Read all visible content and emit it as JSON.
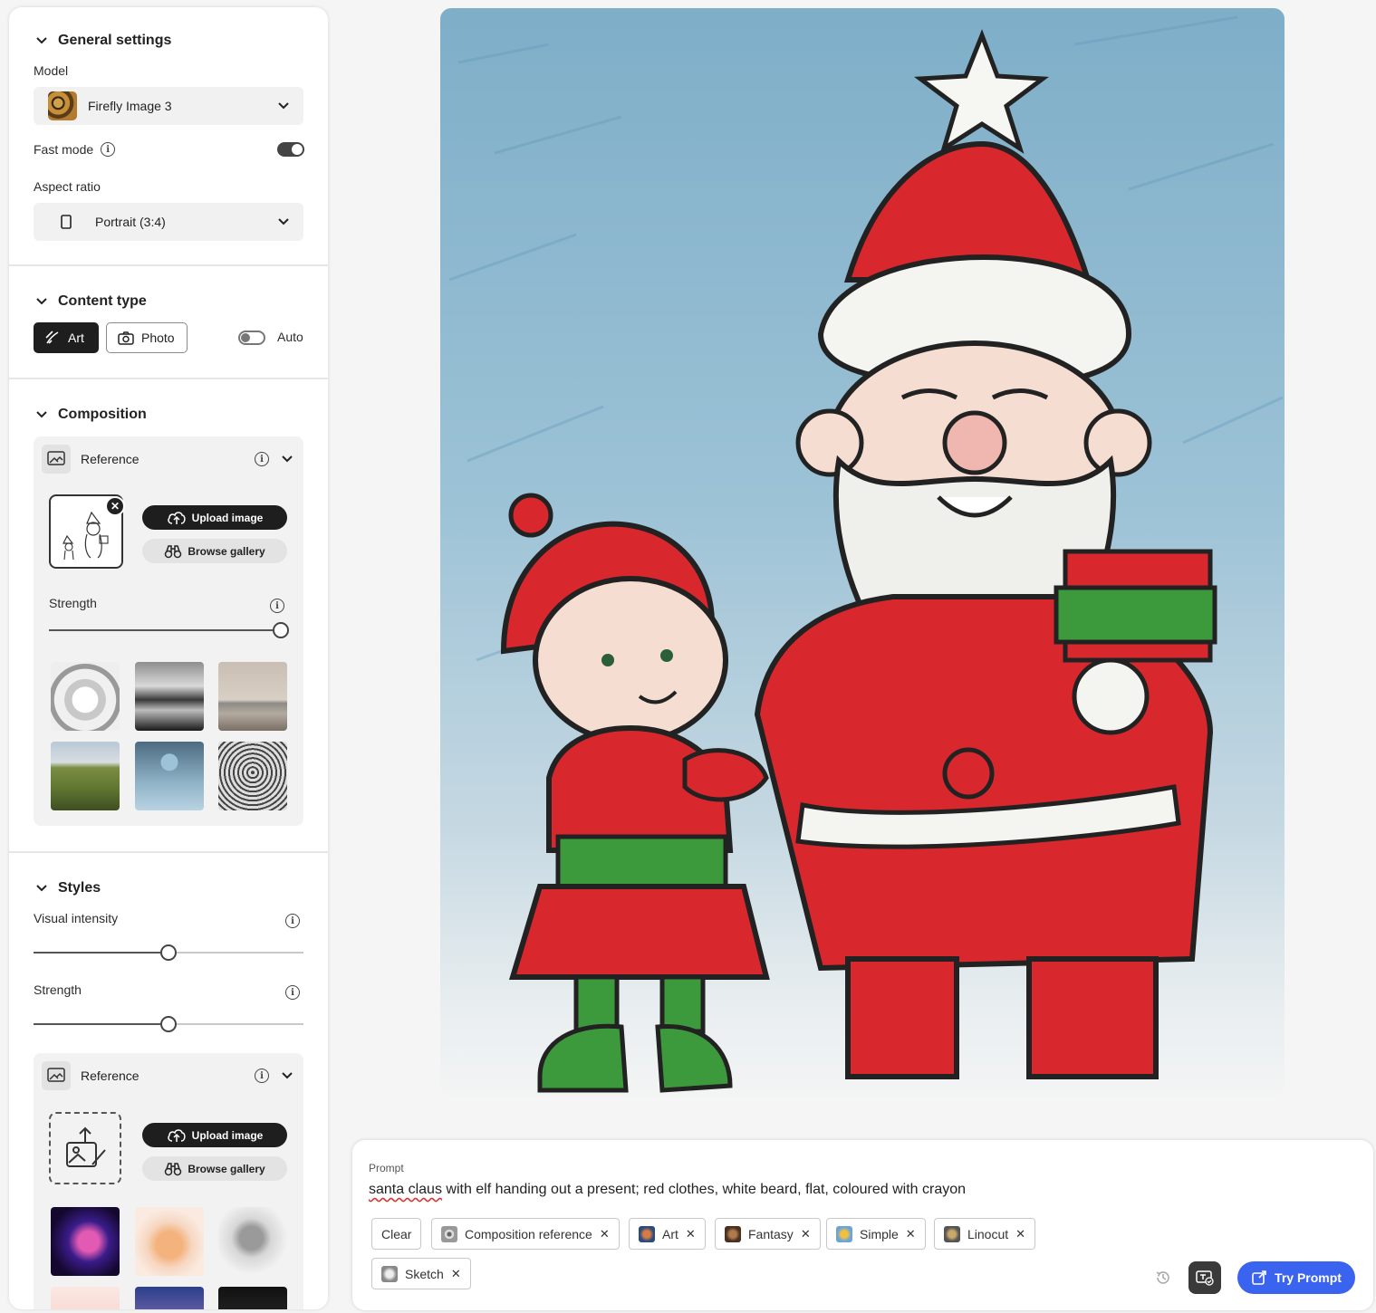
{
  "general": {
    "title": "General settings",
    "model_label": "Model",
    "model_value": "Firefly Image 3",
    "fast_mode_label": "Fast mode",
    "fast_mode_on": true,
    "aspect_label": "Aspect ratio",
    "aspect_value": "Portrait (3:4)"
  },
  "content_type": {
    "title": "Content type",
    "art_label": "Art",
    "photo_label": "Photo",
    "auto_label": "Auto",
    "auto_on": false
  },
  "composition": {
    "title": "Composition",
    "reference_label": "Reference",
    "upload_label": "Upload image",
    "browse_label": "Browse gallery",
    "strength_label": "Strength",
    "strength_value": 1.0
  },
  "styles": {
    "title": "Styles",
    "visual_intensity_label": "Visual intensity",
    "visual_intensity_value": 0.5,
    "strength_label": "Strength",
    "strength_value": 0.5,
    "reference_label": "Reference",
    "upload_label": "Upload image",
    "browse_label": "Browse gallery"
  },
  "prompt": {
    "label": "Prompt",
    "text_part1": "santa claus",
    "text_part2": " with elf handing out a present; red clothes, white beard, flat, coloured with crayon",
    "clear_label": "Clear",
    "chips": [
      "Composition reference",
      "Art",
      "Fantasy",
      "Simple",
      "Linocut",
      "Sketch"
    ],
    "try_label": "Try Prompt"
  },
  "colors": {
    "accent": "#3a63f0",
    "dark": "#1e1e1e"
  }
}
